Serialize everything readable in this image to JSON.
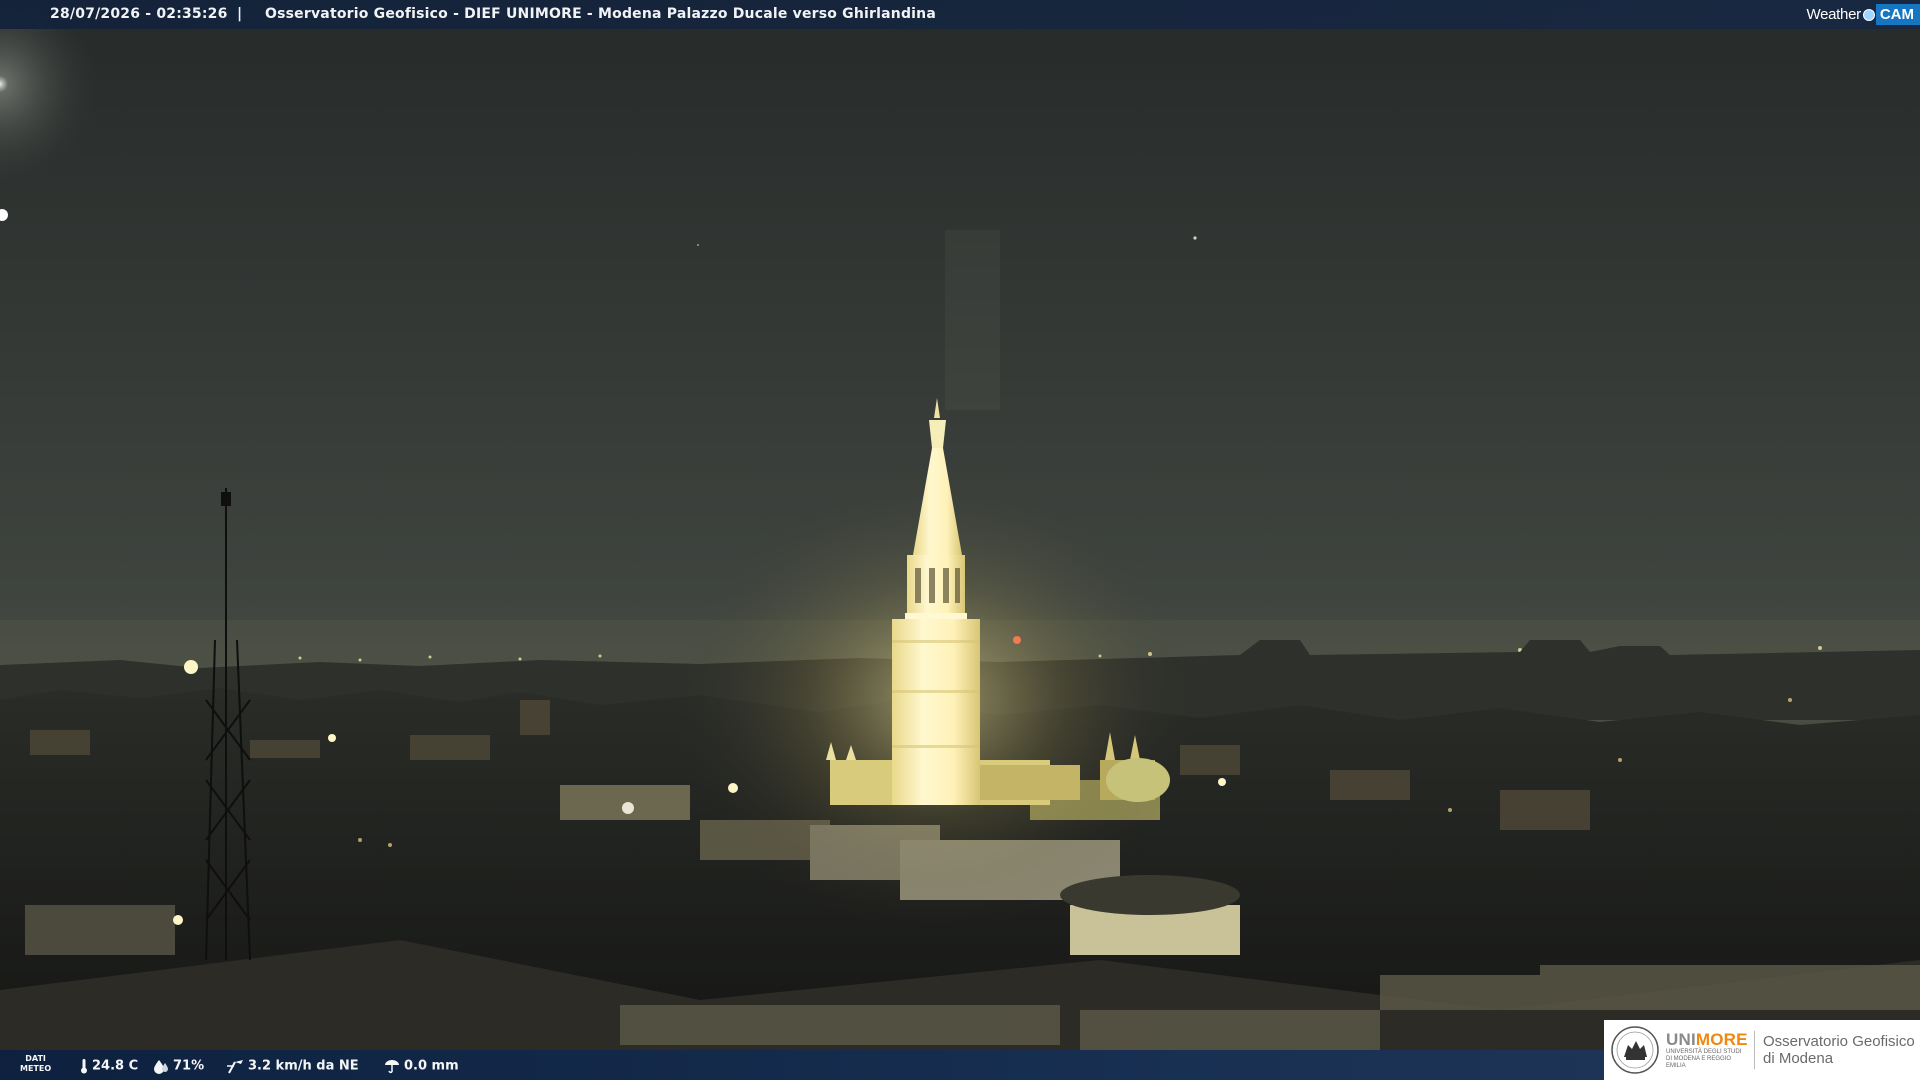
{
  "header": {
    "datetime": "28/07/2026 - 02:35:26",
    "separator": "|",
    "title": "Osservatorio Geofisico - DIEF UNIMORE - Modena Palazzo Ducale verso Ghirlandina"
  },
  "brand": {
    "weather": "Weather",
    "cam": "CAM"
  },
  "weather_data": {
    "label_line1": "DATI",
    "label_line2": "METEO",
    "temperature": "24.8 C",
    "humidity": "71%",
    "wind": "3.2 km/h da NE",
    "rain": "0.0 mm"
  },
  "unimore": {
    "uni": "UNI",
    "more": "MORE",
    "subtitle": "UNIVERSITÀ DEGLI STUDI DI MODENA E REGGIO EMILIA",
    "observatory_line1": "Osservatorio Geofisico",
    "observatory_line2": "di Modena"
  },
  "colors": {
    "sky_top": "#2a2e2c",
    "sky_horizon": "#4c5049",
    "tower_light": "#fff3c0",
    "bar_blue": "#13284a",
    "cam_blue": "#1676c2",
    "unimore_orange": "#f0870f"
  },
  "icons": {
    "temperature": "thermometer-icon",
    "humidity": "drop-icon",
    "wind": "wind-vane-icon",
    "rain": "rain-gauge-icon"
  }
}
